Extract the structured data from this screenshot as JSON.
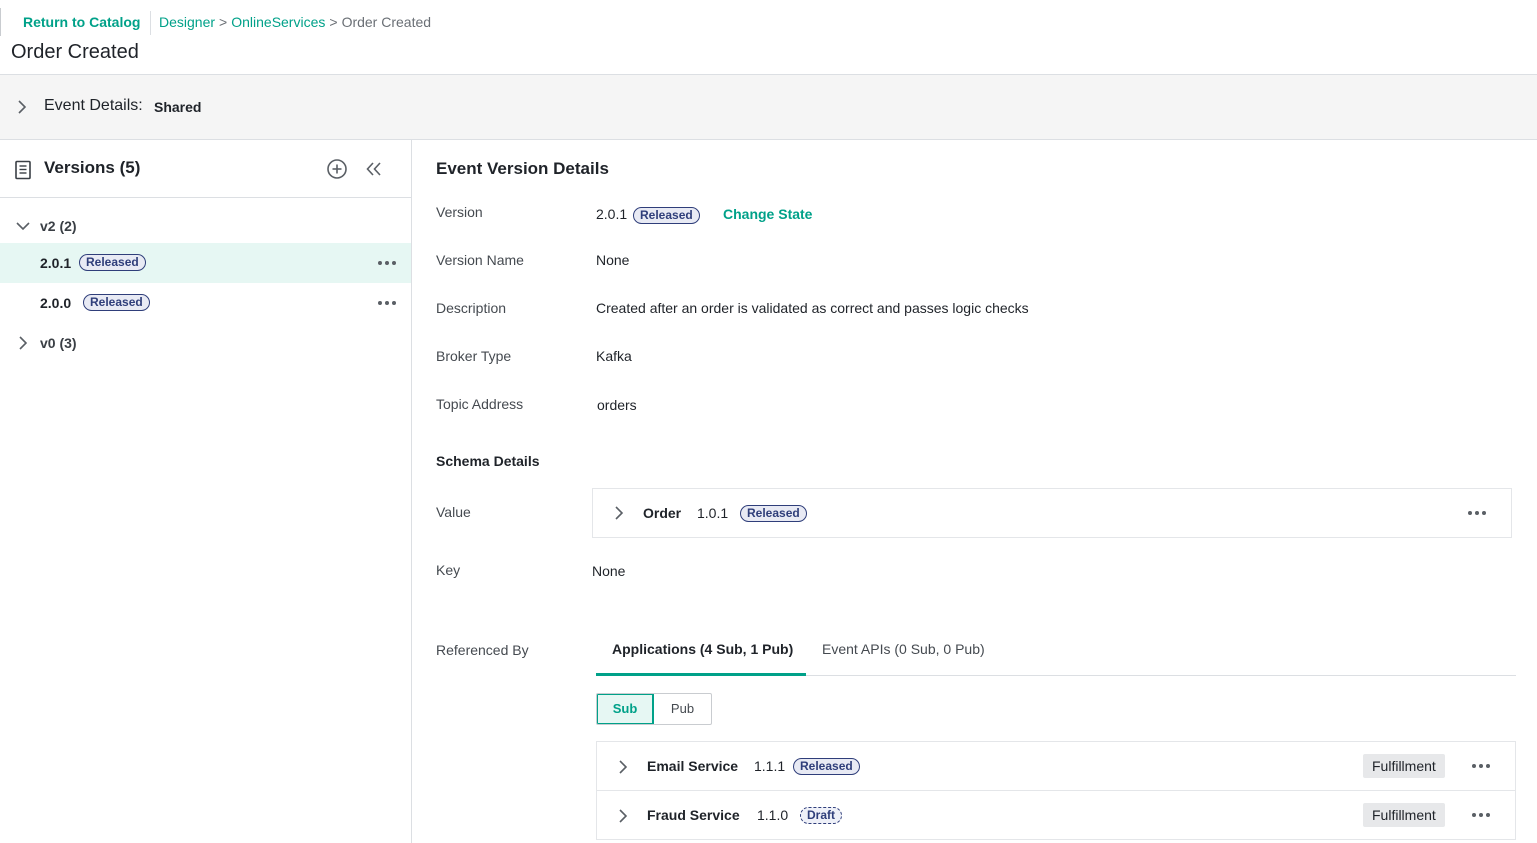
{
  "header": {
    "return_label": "Return to Catalog",
    "breadcrumbs": [
      "Designer",
      "OnlineServices",
      "Order Created"
    ],
    "page_title": "Order Created"
  },
  "event_details": {
    "label": "Event Details:",
    "value": "Shared"
  },
  "versions_panel": {
    "title": "Versions (5)",
    "groups": [
      {
        "label": "v2 (2)",
        "expanded": true,
        "versions": [
          {
            "number": "2.0.1",
            "state": "Released",
            "selected": true
          },
          {
            "number": "2.0.0",
            "state": "Released",
            "selected": false
          }
        ]
      },
      {
        "label": "v0 (3)",
        "expanded": false
      }
    ]
  },
  "details": {
    "title": "Event Version Details",
    "fields": {
      "version_label": "Version",
      "version_value": "2.0.1",
      "version_state": "Released",
      "change_state_label": "Change State",
      "version_name_label": "Version Name",
      "version_name_value": "None",
      "description_label": "Description",
      "description_value": "Created after an order is validated as correct and passes logic checks",
      "broker_type_label": "Broker Type",
      "broker_type_value": "Kafka",
      "topic_address_label": "Topic Address",
      "topic_address_value": "orders"
    },
    "schema": {
      "title": "Schema Details",
      "value_label": "Value",
      "value_schema": {
        "name": "Order",
        "version": "1.0.1",
        "state": "Released"
      },
      "key_label": "Key",
      "key_value": "None"
    },
    "referenced_by": {
      "label": "Referenced By",
      "tabs": [
        {
          "label": "Applications (4 Sub, 1 Pub)",
          "active": true
        },
        {
          "label": "Event APIs (0 Sub, 0 Pub)",
          "active": false
        }
      ],
      "toggle": {
        "sub": "Sub",
        "pub": "Pub",
        "active": "Sub"
      },
      "applications": [
        {
          "name": "Email Service",
          "version": "1.1.1",
          "state": "Released",
          "domain": "Fulfillment"
        },
        {
          "name": "Fraud Service",
          "version": "1.1.0",
          "state": "Draft",
          "domain": "Fulfillment"
        }
      ]
    }
  },
  "colors": {
    "accent": "#00a189",
    "badge": "#2f3e7a",
    "selected_row": "#e6f7f3"
  },
  "icons": {
    "chevron_right": "chevron-right-icon",
    "chevron_down": "chevron-down-icon",
    "document": "document-icon",
    "add": "add-circle-icon",
    "collapse": "double-chevron-left-icon",
    "more": "more-horizontal-icon"
  }
}
